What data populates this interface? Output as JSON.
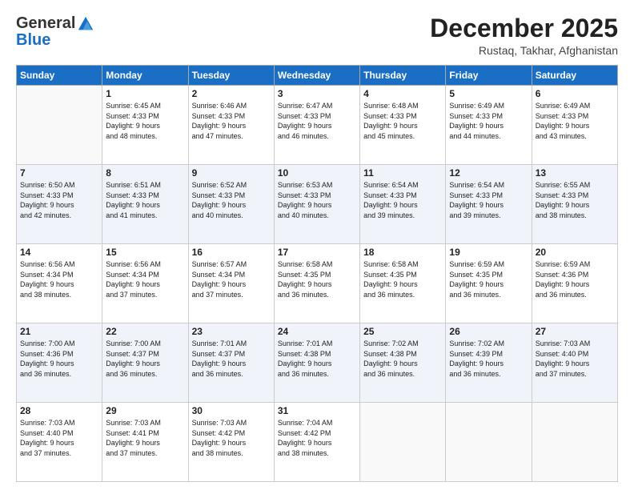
{
  "logo": {
    "general": "General",
    "blue": "Blue"
  },
  "header": {
    "month": "December 2025",
    "location": "Rustaq, Takhar, Afghanistan"
  },
  "days_of_week": [
    "Sunday",
    "Monday",
    "Tuesday",
    "Wednesday",
    "Thursday",
    "Friday",
    "Saturday"
  ],
  "weeks": [
    [
      {
        "day": "",
        "info": ""
      },
      {
        "day": "1",
        "info": "Sunrise: 6:45 AM\nSunset: 4:33 PM\nDaylight: 9 hours\nand 48 minutes."
      },
      {
        "day": "2",
        "info": "Sunrise: 6:46 AM\nSunset: 4:33 PM\nDaylight: 9 hours\nand 47 minutes."
      },
      {
        "day": "3",
        "info": "Sunrise: 6:47 AM\nSunset: 4:33 PM\nDaylight: 9 hours\nand 46 minutes."
      },
      {
        "day": "4",
        "info": "Sunrise: 6:48 AM\nSunset: 4:33 PM\nDaylight: 9 hours\nand 45 minutes."
      },
      {
        "day": "5",
        "info": "Sunrise: 6:49 AM\nSunset: 4:33 PM\nDaylight: 9 hours\nand 44 minutes."
      },
      {
        "day": "6",
        "info": "Sunrise: 6:49 AM\nSunset: 4:33 PM\nDaylight: 9 hours\nand 43 minutes."
      }
    ],
    [
      {
        "day": "7",
        "info": "Sunrise: 6:50 AM\nSunset: 4:33 PM\nDaylight: 9 hours\nand 42 minutes."
      },
      {
        "day": "8",
        "info": "Sunrise: 6:51 AM\nSunset: 4:33 PM\nDaylight: 9 hours\nand 41 minutes."
      },
      {
        "day": "9",
        "info": "Sunrise: 6:52 AM\nSunset: 4:33 PM\nDaylight: 9 hours\nand 40 minutes."
      },
      {
        "day": "10",
        "info": "Sunrise: 6:53 AM\nSunset: 4:33 PM\nDaylight: 9 hours\nand 40 minutes."
      },
      {
        "day": "11",
        "info": "Sunrise: 6:54 AM\nSunset: 4:33 PM\nDaylight: 9 hours\nand 39 minutes."
      },
      {
        "day": "12",
        "info": "Sunrise: 6:54 AM\nSunset: 4:33 PM\nDaylight: 9 hours\nand 39 minutes."
      },
      {
        "day": "13",
        "info": "Sunrise: 6:55 AM\nSunset: 4:33 PM\nDaylight: 9 hours\nand 38 minutes."
      }
    ],
    [
      {
        "day": "14",
        "info": "Sunrise: 6:56 AM\nSunset: 4:34 PM\nDaylight: 9 hours\nand 38 minutes."
      },
      {
        "day": "15",
        "info": "Sunrise: 6:56 AM\nSunset: 4:34 PM\nDaylight: 9 hours\nand 37 minutes."
      },
      {
        "day": "16",
        "info": "Sunrise: 6:57 AM\nSunset: 4:34 PM\nDaylight: 9 hours\nand 37 minutes."
      },
      {
        "day": "17",
        "info": "Sunrise: 6:58 AM\nSunset: 4:35 PM\nDaylight: 9 hours\nand 36 minutes."
      },
      {
        "day": "18",
        "info": "Sunrise: 6:58 AM\nSunset: 4:35 PM\nDaylight: 9 hours\nand 36 minutes."
      },
      {
        "day": "19",
        "info": "Sunrise: 6:59 AM\nSunset: 4:35 PM\nDaylight: 9 hours\nand 36 minutes."
      },
      {
        "day": "20",
        "info": "Sunrise: 6:59 AM\nSunset: 4:36 PM\nDaylight: 9 hours\nand 36 minutes."
      }
    ],
    [
      {
        "day": "21",
        "info": "Sunrise: 7:00 AM\nSunset: 4:36 PM\nDaylight: 9 hours\nand 36 minutes."
      },
      {
        "day": "22",
        "info": "Sunrise: 7:00 AM\nSunset: 4:37 PM\nDaylight: 9 hours\nand 36 minutes."
      },
      {
        "day": "23",
        "info": "Sunrise: 7:01 AM\nSunset: 4:37 PM\nDaylight: 9 hours\nand 36 minutes."
      },
      {
        "day": "24",
        "info": "Sunrise: 7:01 AM\nSunset: 4:38 PM\nDaylight: 9 hours\nand 36 minutes."
      },
      {
        "day": "25",
        "info": "Sunrise: 7:02 AM\nSunset: 4:38 PM\nDaylight: 9 hours\nand 36 minutes."
      },
      {
        "day": "26",
        "info": "Sunrise: 7:02 AM\nSunset: 4:39 PM\nDaylight: 9 hours\nand 36 minutes."
      },
      {
        "day": "27",
        "info": "Sunrise: 7:03 AM\nSunset: 4:40 PM\nDaylight: 9 hours\nand 37 minutes."
      }
    ],
    [
      {
        "day": "28",
        "info": "Sunrise: 7:03 AM\nSunset: 4:40 PM\nDaylight: 9 hours\nand 37 minutes."
      },
      {
        "day": "29",
        "info": "Sunrise: 7:03 AM\nSunset: 4:41 PM\nDaylight: 9 hours\nand 37 minutes."
      },
      {
        "day": "30",
        "info": "Sunrise: 7:03 AM\nSunset: 4:42 PM\nDaylight: 9 hours\nand 38 minutes."
      },
      {
        "day": "31",
        "info": "Sunrise: 7:04 AM\nSunset: 4:42 PM\nDaylight: 9 hours\nand 38 minutes."
      },
      {
        "day": "",
        "info": ""
      },
      {
        "day": "",
        "info": ""
      },
      {
        "day": "",
        "info": ""
      }
    ]
  ]
}
